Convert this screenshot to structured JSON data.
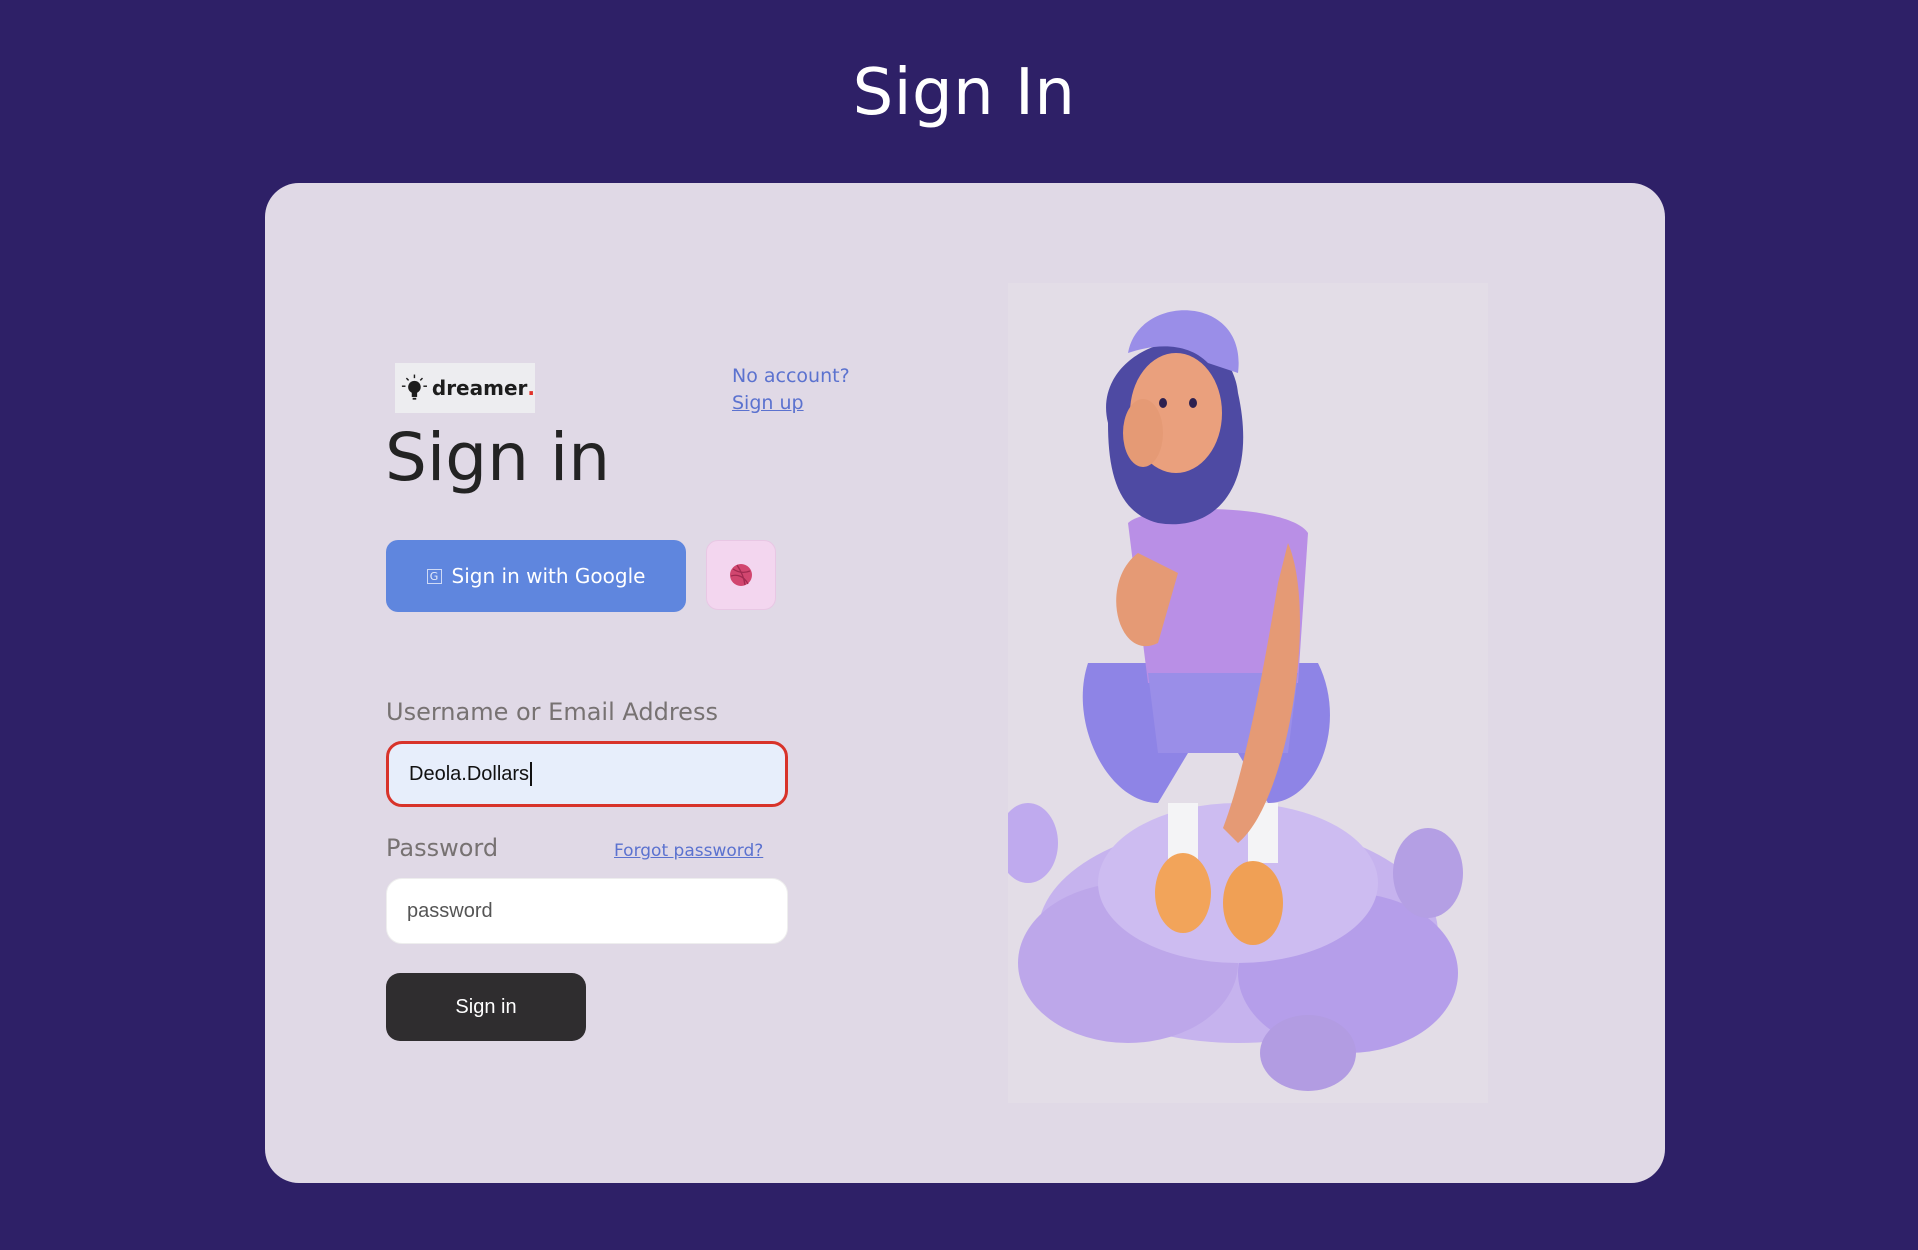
{
  "page": {
    "title": "Sign In"
  },
  "logo": {
    "text": "dreamer",
    "dot": "."
  },
  "signup_prompt": {
    "question": "No account?",
    "link": "Sign up"
  },
  "form": {
    "heading": "Sign in",
    "google_button": "Sign in with Google",
    "google_icon_glyph": "G",
    "dribbble_icon": "dribbble-icon",
    "username": {
      "label": "Username or Email Address",
      "value": "Deola.Dollars"
    },
    "password": {
      "label": "Password",
      "placeholder": "password",
      "forgot_link": "Forgot password?"
    },
    "submit_label": "Sign in"
  },
  "colors": {
    "background": "#2e2067",
    "card": "#e0d9e6",
    "google_button": "#5f86de",
    "link": "#5b72cf",
    "focus_border": "#d8332a",
    "submit_button": "#2f2d2f"
  }
}
